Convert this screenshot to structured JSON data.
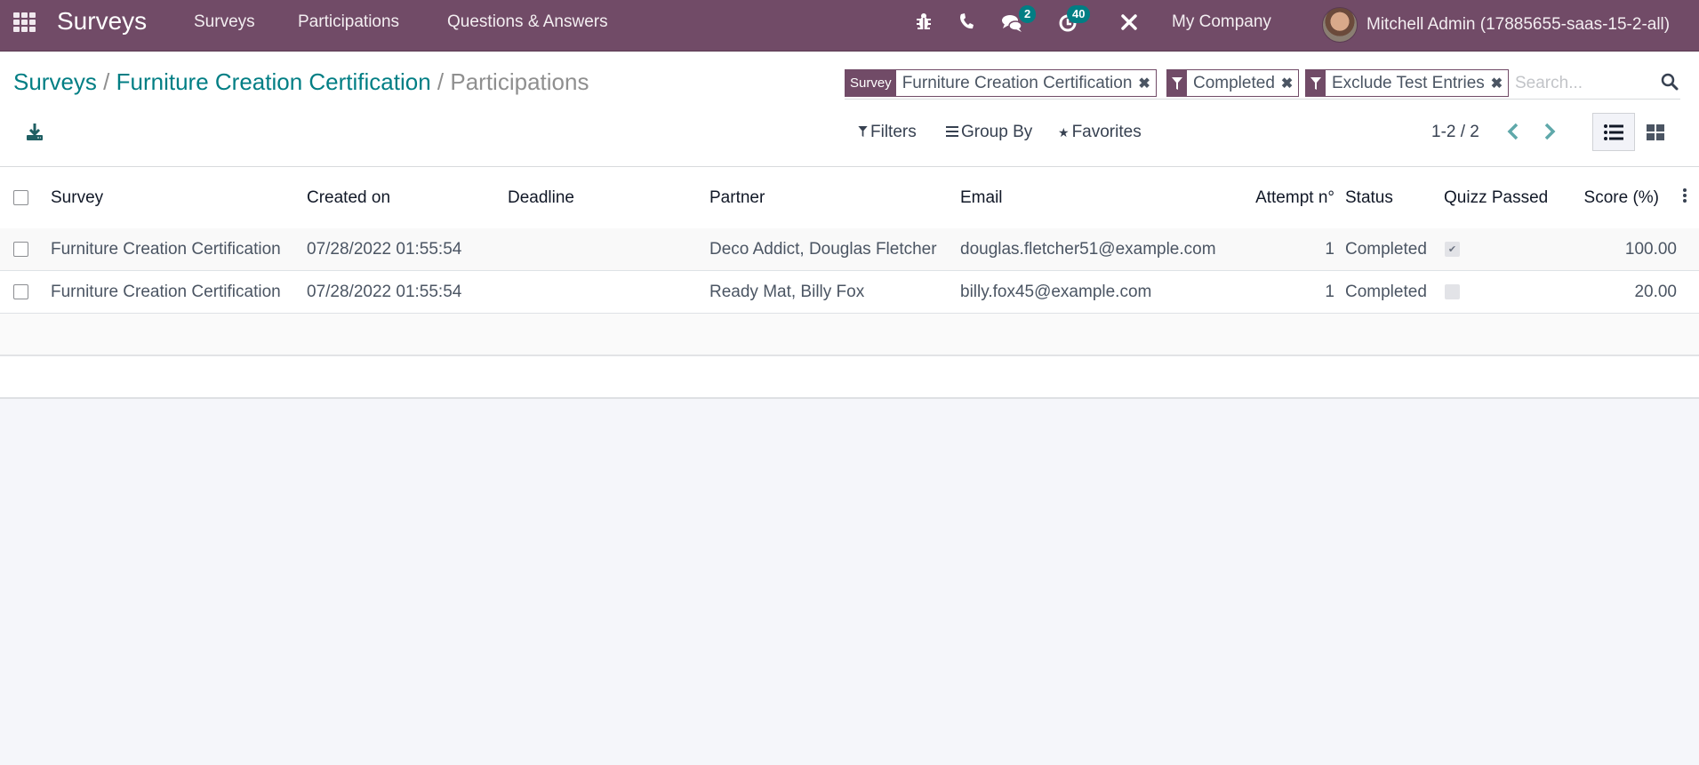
{
  "navbar": {
    "brand": "Surveys",
    "menu": [
      "Surveys",
      "Participations",
      "Questions & Answers"
    ],
    "icons": [
      "bug-icon",
      "phone-icon",
      "chat-icon",
      "activity-clock-icon",
      "tools-icon"
    ],
    "messages_badge": "2",
    "activities_badge": "40",
    "company": "My Company",
    "user": "Mitchell Admin (17885655-saas-15-2-all)"
  },
  "breadcrumb": {
    "items": [
      "Surveys",
      "Furniture Creation Certification"
    ],
    "separator": "/",
    "current": "Participations"
  },
  "search": {
    "facets": [
      {
        "label": "Survey",
        "value": "Furniture Creation Certification",
        "type": "field"
      },
      {
        "label": "filter-icon",
        "value": "Completed",
        "type": "filter"
      },
      {
        "label": "filter-icon",
        "value": "Exclude Test Entries",
        "type": "filter"
      }
    ],
    "placeholder": "Search..."
  },
  "controls": {
    "filters": "Filters",
    "group_by": "Group By",
    "favorites": "Favorites",
    "pager": "1-2 / 2",
    "active_view": "list"
  },
  "colors": {
    "brand": "#714b67",
    "accent": "#017e84"
  },
  "table": {
    "columns": [
      "Survey",
      "Created on",
      "Deadline",
      "Partner",
      "Email",
      "Attempt n°",
      "Status",
      "Quizz Passed",
      "Score (%)"
    ],
    "rows": [
      {
        "survey": "Furniture Creation Certification",
        "created_on": "07/28/2022 01:55:54",
        "deadline": "",
        "partner": "Deco Addict, Douglas Fletcher",
        "email": "douglas.fletcher51@example.com",
        "attempt": "1",
        "status": "Completed",
        "quizz_passed": true,
        "quizz_mark": "✔",
        "score": "100.00"
      },
      {
        "survey": "Furniture Creation Certification",
        "created_on": "07/28/2022 01:55:54",
        "deadline": "",
        "partner": "Ready Mat, Billy Fox",
        "email": "billy.fox45@example.com",
        "attempt": "1",
        "status": "Completed",
        "quizz_passed": false,
        "quizz_mark": "",
        "score": "20.00"
      }
    ]
  }
}
